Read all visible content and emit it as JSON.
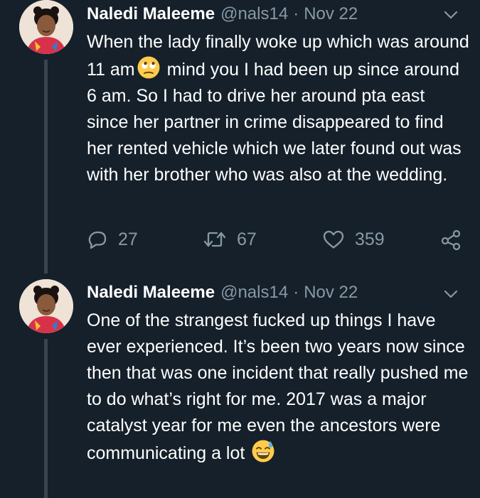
{
  "tweets": [
    {
      "display_name": "Naledi Maleeme",
      "handle": "@nals14",
      "separator": "·",
      "date": "Nov 22",
      "text_before_emoji": "When the lady finally woke up which was around 11 am",
      "emoji": "rolling-eyes-face",
      "text_after_emoji": " mind you I had been up since around 6 am. So I had to drive her around pta east since her partner in crime disappeared to find her rented vehicle which we later found out was with her brother who was also at the wedding.",
      "replies": "27",
      "retweets": "67",
      "likes": "359"
    },
    {
      "display_name": "Naledi Maleeme",
      "handle": "@nals14",
      "separator": "·",
      "date": "Nov 22",
      "text_before_emoji": "One of the strangest fucked up things I have ever experienced. It’s been two years now since then that was one incident that really pushed me to do what’s right for me. 2017 was a major catalyst year for me even the ancestors were communicating a lot ",
      "emoji": "grinning-face-with-sweat"
    }
  ],
  "colors": {
    "background": "#15202b",
    "text": "#ffffff",
    "secondary": "#8899a6",
    "thread_line": "#38444d"
  }
}
